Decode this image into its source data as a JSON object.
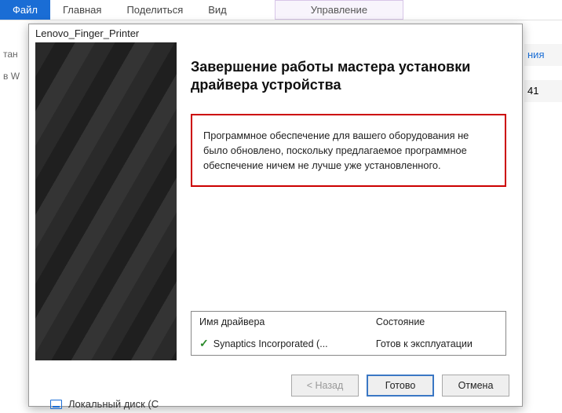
{
  "ribbon": {
    "file": "Файл",
    "home": "Главная",
    "share": "Поделиться",
    "view": "Вид",
    "manage": "Управление"
  },
  "bg": {
    "left1": "тан",
    "left2": "в W",
    "right1": "ния",
    "right2": "41"
  },
  "dialog": {
    "title": "Lenovo_Finger_Printer",
    "heading": "Завершение работы мастера установки драйвера устройства",
    "message": "Программное обеспечение для вашего оборудования не было обновлено, поскольку предлагаемое программное обеспечение ничем не лучше уже установленного.",
    "table": {
      "col_name": "Имя драйвера",
      "col_state": "Состояние",
      "row": {
        "name": "Synaptics Incorporated (...",
        "state": "Готов к эксплуатации"
      }
    },
    "buttons": {
      "back": "< Назад",
      "done": "Готово",
      "cancel": "Отмена"
    }
  },
  "bottom": {
    "drive": "Локальный диск (С"
  }
}
